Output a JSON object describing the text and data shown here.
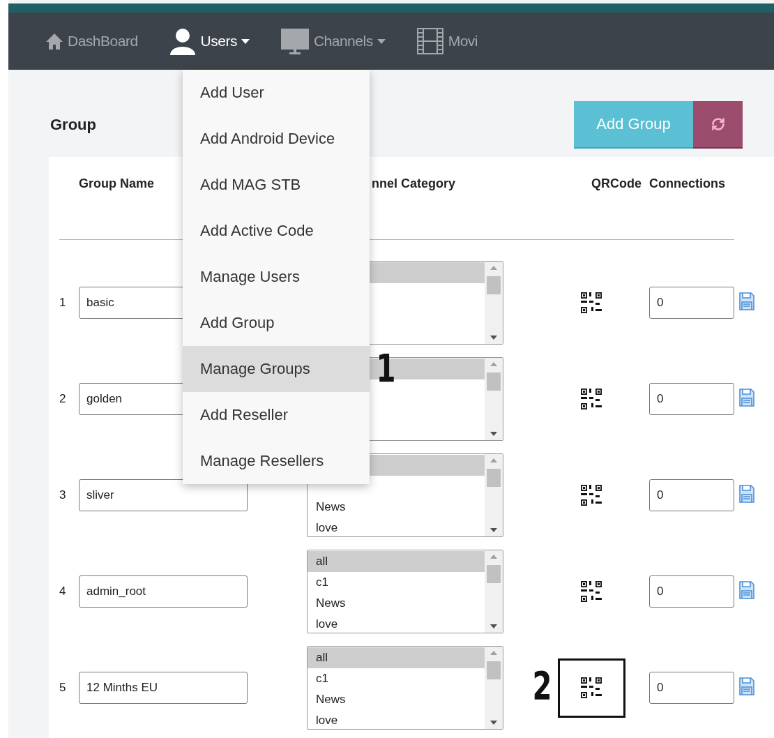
{
  "navbar": {
    "items": [
      {
        "label": "DashBoard",
        "kind": "home",
        "active": false,
        "caret": false
      },
      {
        "label": "Users",
        "kind": "user",
        "active": true,
        "caret": true
      },
      {
        "label": "Channels",
        "kind": "monitor",
        "active": false,
        "caret": true
      },
      {
        "label": "Movi",
        "kind": "film",
        "active": false,
        "caret": false
      }
    ]
  },
  "users_menu": {
    "items": [
      {
        "label": "Add User",
        "selected": false
      },
      {
        "label": "Add Android Device",
        "selected": false
      },
      {
        "label": "Add MAG STB",
        "selected": false
      },
      {
        "label": "Add Active Code",
        "selected": false
      },
      {
        "label": "Manage Users",
        "selected": false
      },
      {
        "label": "Add Group",
        "selected": false
      },
      {
        "label": "Manage Groups",
        "selected": true
      },
      {
        "label": "Add Reseller",
        "selected": false
      },
      {
        "label": "Manage Resellers",
        "selected": false
      }
    ]
  },
  "page_title": "Group",
  "buttons": {
    "add": "Add Group"
  },
  "table": {
    "columns": [
      "Group Name",
      "nnel Category",
      "QRCode",
      "Connections"
    ],
    "rows": [
      {
        "number": "1",
        "name": "basic",
        "options": [
          {
            "selected": true
          }
        ],
        "connections": "0",
        "highlighted": false
      },
      {
        "number": "2",
        "name": "golden",
        "options": [
          {
            "selected": true
          }
        ],
        "connections": "0",
        "highlighted": false
      },
      {
        "number": "3",
        "name": "sliver",
        "options": [
          {
            "selected": true
          },
          {
            "selected": false
          },
          {
            "label": "News",
            "selected": false
          },
          {
            "label": "love",
            "selected": false
          }
        ],
        "connections": "0",
        "highlighted": false
      },
      {
        "number": "4",
        "name": "admin_root",
        "options": [
          {
            "label": "all",
            "selected": true
          },
          {
            "label": "c1",
            "selected": false
          },
          {
            "label": "News",
            "selected": false
          },
          {
            "label": "love",
            "selected": false
          }
        ],
        "connections": "0",
        "highlighted": false
      },
      {
        "number": "5",
        "name": "12 Minths EU",
        "options": [
          {
            "label": "all",
            "selected": true
          },
          {
            "label": "c1",
            "selected": false
          },
          {
            "label": "News",
            "selected": false
          },
          {
            "label": "love",
            "selected": false
          }
        ],
        "connections": "0",
        "highlighted": true
      }
    ]
  },
  "annotations": [
    {
      "label": "1"
    },
    {
      "label": "2"
    }
  ]
}
